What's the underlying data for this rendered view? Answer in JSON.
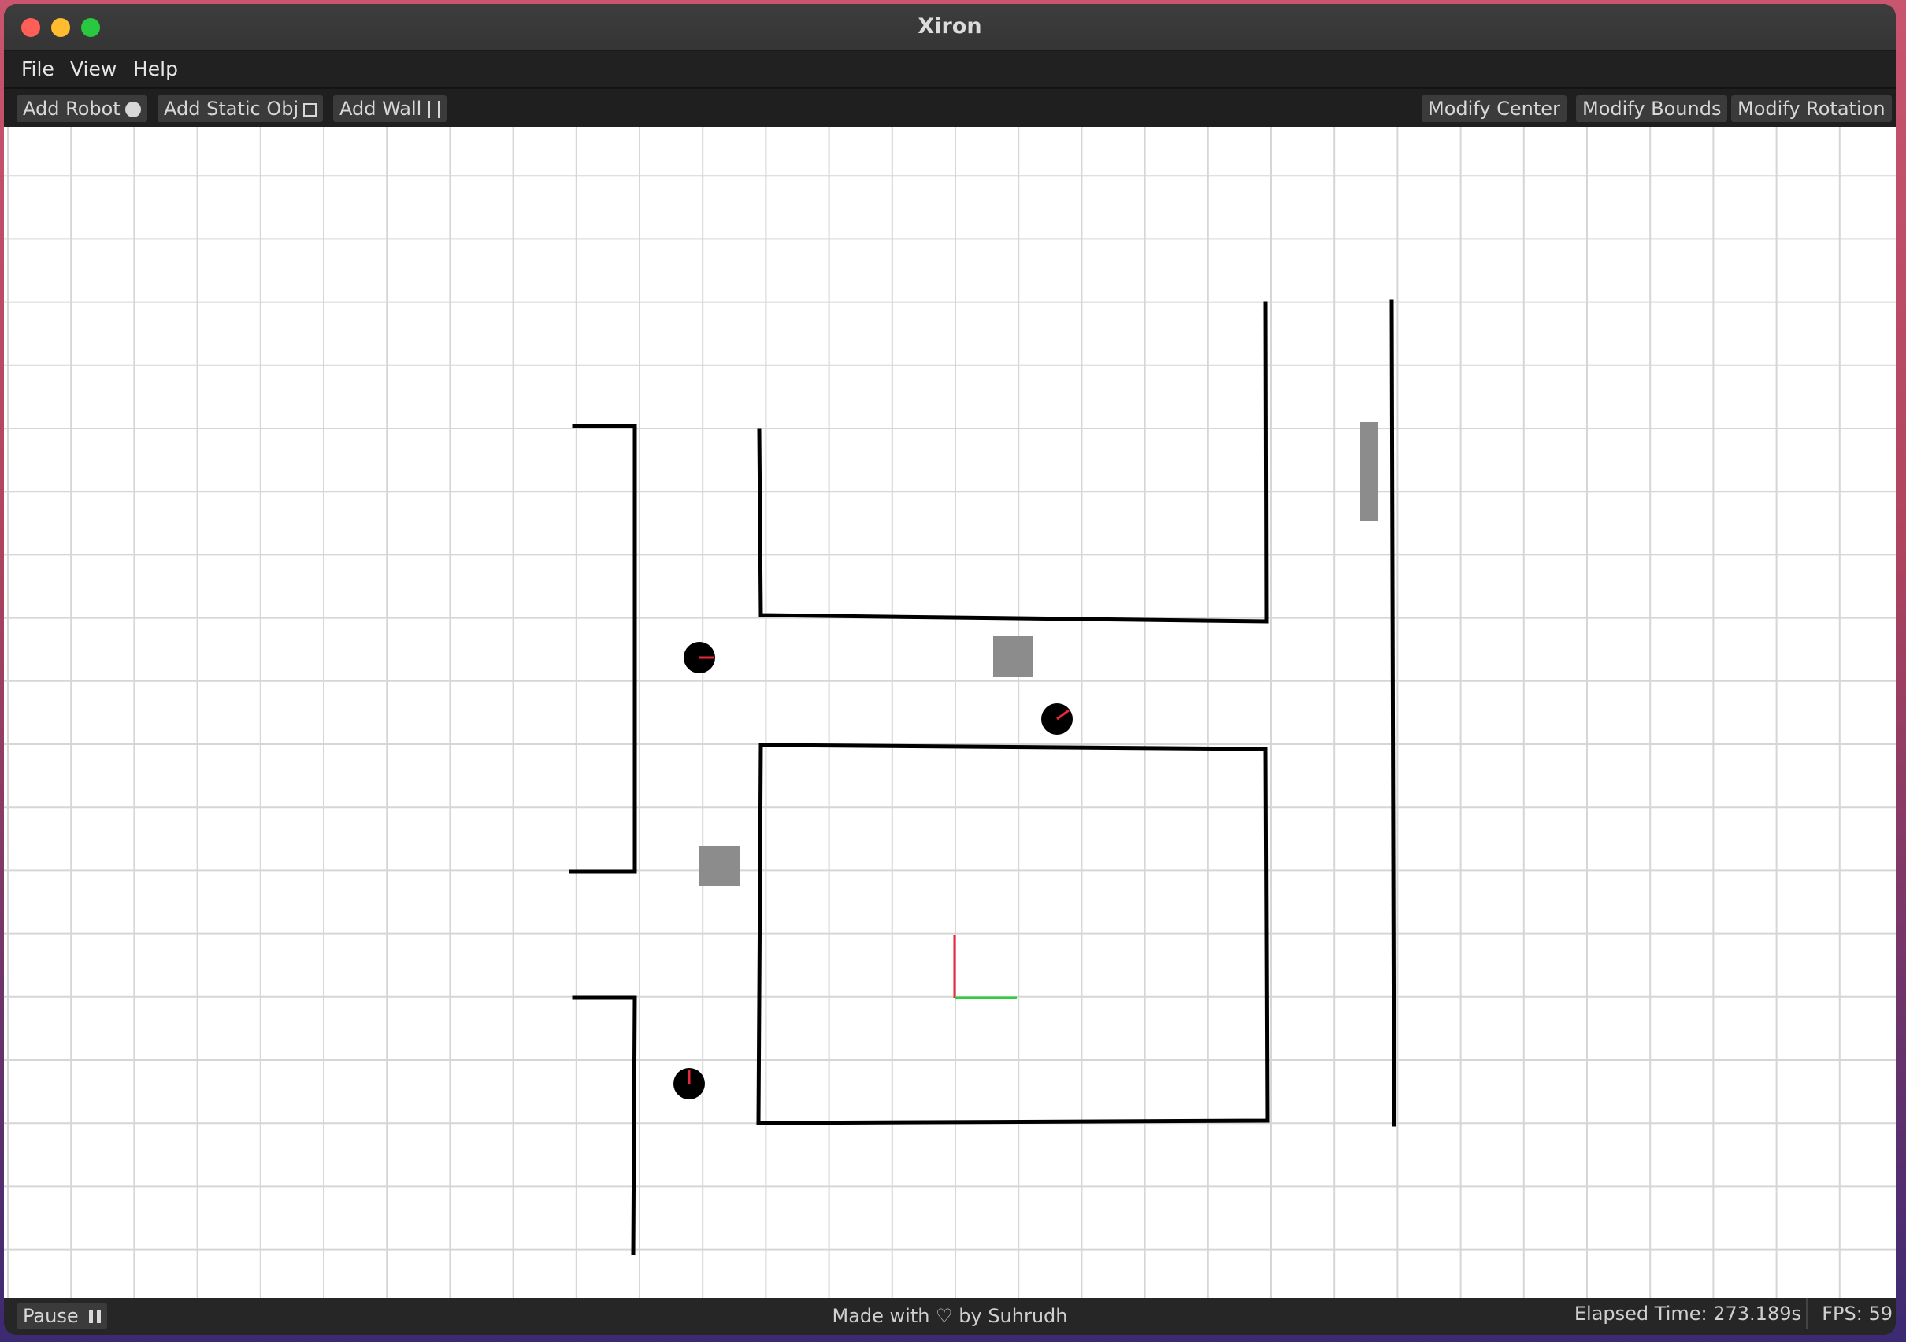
{
  "window": {
    "title": "Xiron"
  },
  "menu": {
    "file": "File",
    "view": "View",
    "help": "Help"
  },
  "toolbar": {
    "add_robot": "Add Robot",
    "add_static": "Add Static Obj",
    "add_wall": "Add Wall",
    "modify_center": "Modify Center",
    "modify_bounds": "Modify Bounds",
    "modify_rotation": "Modify Rotation"
  },
  "status": {
    "pause": "Pause",
    "credit_prefix": "Made with",
    "credit_suffix": "by Suhrudh",
    "elapsed": "Elapsed Time: 273.189s",
    "fps": "FPS: 59"
  },
  "colors": {
    "robot_heading": "#e8273a",
    "axis_x": "#2ecc40",
    "axis_y": "#e8273a",
    "static_obj": "#8c8c8c",
    "wall": "#000000",
    "grid": "#d6d6d6"
  },
  "icons": {
    "robot": "circle-icon",
    "static": "square-icon",
    "wall": "wall-bars-icon",
    "pause": "pause-icon",
    "heart": "heart-icon"
  }
}
